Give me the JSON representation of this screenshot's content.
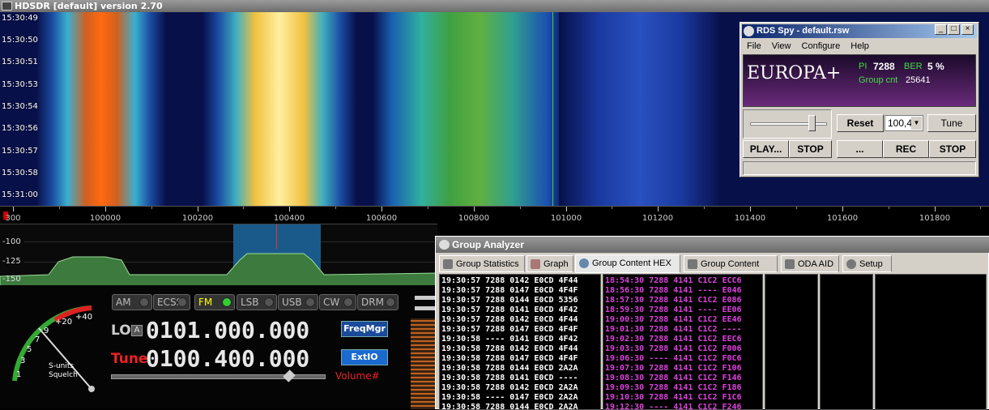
{
  "app": {
    "title": "HDSDR [default]  version 2.70"
  },
  "waterfall": {
    "times": [
      "15:30:49",
      "15:30:50",
      "15:30:51",
      "15:30:53",
      "15:30:54",
      "15:30:56",
      "15:30:57",
      "15:30:58",
      "15:31:00"
    ]
  },
  "freq_scale": {
    "left_fragment": "300",
    "labels": [
      "100000",
      "100200",
      "100400",
      "100600",
      "100800",
      "101000",
      "101200",
      "101400",
      "101600",
      "101800"
    ]
  },
  "spectrum": {
    "db_labels": [
      "-100",
      "-125",
      "-150"
    ]
  },
  "modes": [
    {
      "label": "AM",
      "active": false
    },
    {
      "label": "ECSS",
      "active": false
    },
    {
      "label": "FM",
      "active": true
    },
    {
      "label": "LSB",
      "active": false
    },
    {
      "label": "USB",
      "active": false
    },
    {
      "label": "CW",
      "active": false
    },
    {
      "label": "DRM",
      "active": false
    }
  ],
  "lo": {
    "label": "LO",
    "lock": "A",
    "value": "0101.000.000"
  },
  "tune": {
    "label": "Tune",
    "value": "0100.400.000"
  },
  "buttons": {
    "freqmgr": "FreqMgr",
    "extio": "ExtIO",
    "volume": "Volume#"
  },
  "smeter": {
    "labels": [
      "+40",
      "+20",
      "9",
      "7",
      "5",
      "3",
      "1"
    ],
    "caption1": "S-units",
    "caption2": "Squelch"
  },
  "rds": {
    "title": "RDS Spy - default.rsw",
    "menu": [
      "File",
      "View",
      "Configure",
      "Help"
    ],
    "ps": "EUROPA+",
    "pi_label": "PI",
    "pi_value": "7288",
    "ber_label": "BER",
    "ber_value": "5 %",
    "group_label": "Group cnt",
    "group_value": "25641",
    "reset": "Reset",
    "freq": "100,4",
    "tune": "Tune",
    "play": "PLAY...",
    "stop1": "STOP",
    "ellipsis": "...",
    "rec": "REC",
    "stop2": "STOP"
  },
  "ga": {
    "title": "Group Analyzer",
    "tabs": [
      "Group Statistics",
      "Graph",
      "Group Content HEX",
      "Group Content Full",
      "ODA AID",
      "Setup"
    ],
    "active_tab": 2,
    "left_rows": [
      "19:30:57 7288 0142 E0CD 4F44",
      "19:30:57 7288 0147 E0CD 4F4F",
      "19:30:57 7288 0144 E0CD 5356",
      "19:30:57 7288 0141 E0CD 4F42",
      "19:30:57 7288 0142 E0CD 4F44",
      "19:30:57 7288 0147 E0CD 4F4F",
      "19:30:58 ---- 0141 E0CD 4F42",
      "19:30:58 7288 0142 E0CD 4F44",
      "19:30:58 7288 0147 E0CD 4F4F",
      "19:30:58 7288 0144 E0CD 2A2A",
      "19:30:58 7288 0141 E0CD ----",
      "19:30:58 7288 0142 E0CD 2A2A",
      "19:30:58 ---- 0147 E0CD 2A2A",
      "19:30:58 7288 0144 E0CD 2A2A"
    ],
    "right_rows": [
      "18:54:30 7288 4141 C1C2 ECC6",
      "18:56:30 7288 4141 ---- E046",
      "18:57:30 7288 4141 C1C2 E086",
      "18:59:30 7288 4141 ---- EE06",
      "19:00:30 7288 4141 C1C2 EE46",
      "19:01:30 7288 4141 C1C2 ----",
      "19:02:30 7288 4141 C1C2 EEC6",
      "19:03:30 7288 4141 C1C2 F006",
      "19:06:30 ---- 4141 C1C2 F0C6",
      "19:07:30 7288 4141 C1C2 F106",
      "19:08:30 7288 4141 C1C2 F146",
      "19:09:30 7288 4141 C1C2 F186",
      "19:10:30 7288 4141 C1C2 F1C6",
      "19:12:30 ---- 4141 C1C2 F246"
    ]
  }
}
